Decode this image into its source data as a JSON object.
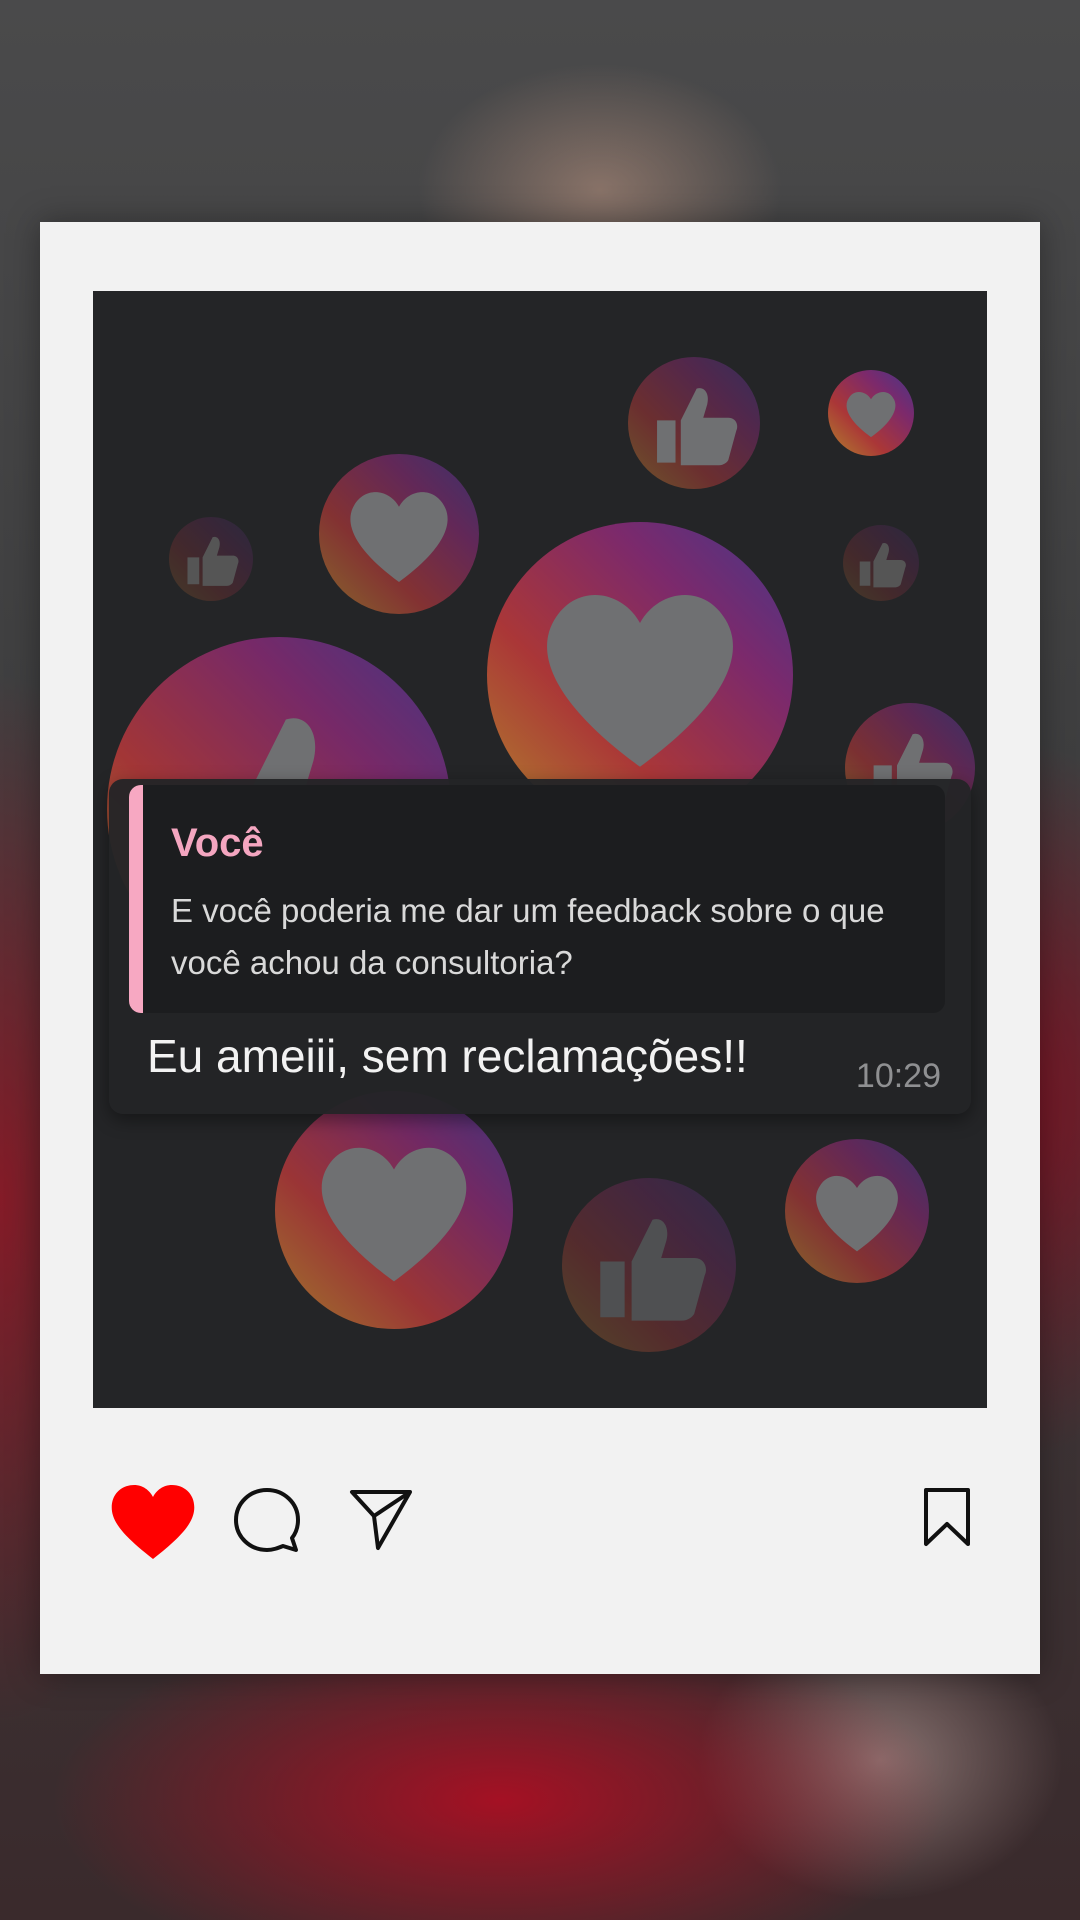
{
  "post": {
    "chat": {
      "quoted_sender": "Você",
      "quoted_message": "E você poderia me dar um feedback sobre o que você achou da consultoria?",
      "reply_message": "Eu ameiii, sem reclamações!!",
      "timestamp": "10:29"
    },
    "background_icons": [
      "heart-icon",
      "thumbs-up-icon"
    ],
    "actions": {
      "like": {
        "icon": "heart-icon",
        "state": "liked",
        "color": "#ff0000"
      },
      "comment": {
        "icon": "comment-icon"
      },
      "share": {
        "icon": "send-icon"
      },
      "save": {
        "icon": "bookmark-icon"
      }
    }
  },
  "colors": {
    "frame": "#f2f2f2",
    "photo_background": "#242527",
    "quote_accent": "#f7a8c2",
    "like": "#ff0000"
  }
}
